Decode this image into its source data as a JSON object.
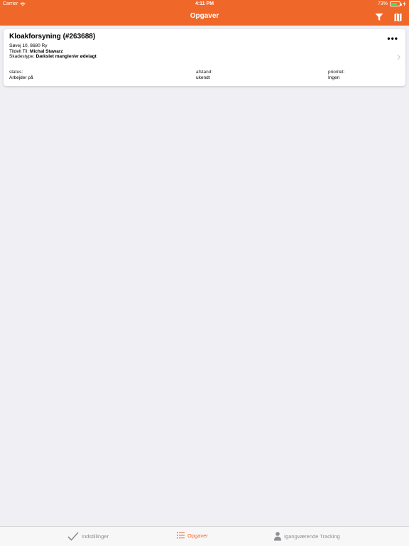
{
  "status_bar": {
    "carrier": "Carrier",
    "time": "4:11 PM",
    "battery": "73%",
    "battery_level": 0.73
  },
  "nav": {
    "title": "Opgaver",
    "filter_icon": "filter-icon",
    "map_icon": "map-icon"
  },
  "task": {
    "title": "Kloakforsyning (#263688)",
    "address": "Søvej 10, 8680 Ry",
    "assigned_label": "Tildelt Til:",
    "assigned_to": "Michal Stawarz",
    "damage_label": "Skadestype:",
    "damage_type": "Dækslet mangler/er ødelagt",
    "more_label": "•••",
    "status_label": "status:",
    "status_value": "Arbejder på",
    "distance_label": "afstand:",
    "distance_value": "ukendt",
    "priority_label": "prioritet:",
    "priority_value": "Ingen"
  },
  "tabs": [
    {
      "label": "Indstillinger",
      "icon": "checkmark-icon",
      "active": false
    },
    {
      "label": "Opgaver",
      "icon": "list-icon",
      "active": true
    },
    {
      "label": "Igangværende Tracking",
      "icon": "person-icon",
      "active": false
    }
  ],
  "colors": {
    "accent": "#f0672a",
    "background": "#efeff4",
    "inactive_tab": "#8e8e93",
    "battery": "#4cd964"
  }
}
